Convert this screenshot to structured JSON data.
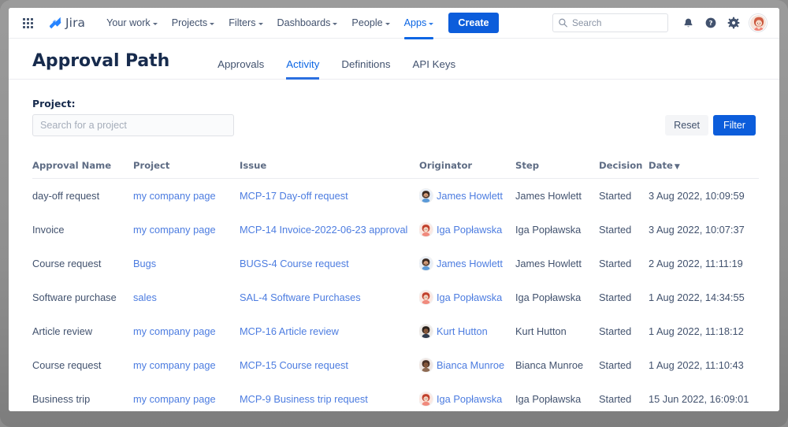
{
  "topnav": {
    "app_switcher_icon": "grid-apps-icon",
    "brand": {
      "logo_icon": "jira-logo-icon",
      "name": "Jira"
    },
    "items": [
      {
        "label": "Your work",
        "has_caret": true,
        "active": false
      },
      {
        "label": "Projects",
        "has_caret": true,
        "active": false
      },
      {
        "label": "Filters",
        "has_caret": true,
        "active": false
      },
      {
        "label": "Dashboards",
        "has_caret": true,
        "active": false
      },
      {
        "label": "People",
        "has_caret": true,
        "active": false
      },
      {
        "label": "Apps",
        "has_caret": true,
        "active": true
      }
    ],
    "create_label": "Create",
    "search": {
      "placeholder": "Search",
      "value": "",
      "icon": "search-icon"
    },
    "icons": [
      {
        "name": "notifications-bell-icon"
      },
      {
        "name": "help-question-icon"
      },
      {
        "name": "settings-gear-icon"
      }
    ],
    "avatar": {
      "name": "user-avatar"
    }
  },
  "page": {
    "title": "Approval Path",
    "tabs": [
      {
        "label": "Approvals",
        "active": false
      },
      {
        "label": "Activity",
        "active": true
      },
      {
        "label": "Definitions",
        "active": false
      },
      {
        "label": "API Keys",
        "active": false
      }
    ]
  },
  "filters": {
    "project_label": "Project:",
    "project_placeholder": "Search for a project",
    "project_value": "",
    "reset_label": "Reset",
    "filter_label": "Filter"
  },
  "table": {
    "columns": [
      {
        "key": "name",
        "label": "Approval Name"
      },
      {
        "key": "project",
        "label": "Project"
      },
      {
        "key": "issue",
        "label": "Issue"
      },
      {
        "key": "originator",
        "label": "Originator"
      },
      {
        "key": "step",
        "label": "Step"
      },
      {
        "key": "decision",
        "label": "Decision"
      },
      {
        "key": "date",
        "label": "Date"
      }
    ],
    "sorted_column": "Date",
    "sort_direction": "▼",
    "rows": [
      {
        "name": "day-off request",
        "project": "my company page",
        "issue": "MCP-17 Day-off request",
        "originator": "James Howlett",
        "avatar": "male-blue",
        "step": "James Howlett",
        "decision": "Started",
        "date": "3 Aug 2022, 10:09:59"
      },
      {
        "name": "Invoice",
        "project": "my company page",
        "issue": "MCP-14 Invoice-2022-06-23 approval",
        "originator": "Iga Popławska",
        "avatar": "female-red",
        "step": "Iga Popławska",
        "decision": "Started",
        "date": "3 Aug 2022, 10:07:37"
      },
      {
        "name": "Course request",
        "project": "Bugs",
        "issue": "BUGS-4 Course request",
        "originator": "James Howlett",
        "avatar": "male-blue",
        "step": "James Howlett",
        "decision": "Started",
        "date": "2 Aug 2022, 11:11:19"
      },
      {
        "name": "Software purchase",
        "project": "sales",
        "issue": "SAL-4 Software Purchases",
        "originator": "Iga Popławska",
        "avatar": "female-red",
        "step": "Iga Popławska",
        "decision": "Started",
        "date": "1 Aug 2022, 14:34:55"
      },
      {
        "name": "Article review",
        "project": "my company page",
        "issue": "MCP-16 Article review",
        "originator": "Kurt Hutton",
        "avatar": "male-dark",
        "step": "Kurt Hutton",
        "decision": "Started",
        "date": "1 Aug 2022, 11:18:12"
      },
      {
        "name": "Course request",
        "project": "my company page",
        "issue": "MCP-15 Course request",
        "originator": "Bianca Munroe",
        "avatar": "female-dark",
        "step": "Bianca Munroe",
        "decision": "Started",
        "date": "1 Aug 2022, 11:10:43"
      },
      {
        "name": "Business trip",
        "project": "my company page",
        "issue": "MCP-9 Business trip request",
        "originator": "Iga Popławska",
        "avatar": "female-red",
        "step": "Iga Popławska",
        "decision": "Started",
        "date": "15 Jun 2022, 16:09:01"
      }
    ]
  },
  "colors": {
    "brand_blue": "#0c5ddb",
    "link_blue": "#4c7ce0",
    "text_dark": "#172b4d",
    "text_muted": "#5e6c84",
    "border": "#ebecf0"
  }
}
